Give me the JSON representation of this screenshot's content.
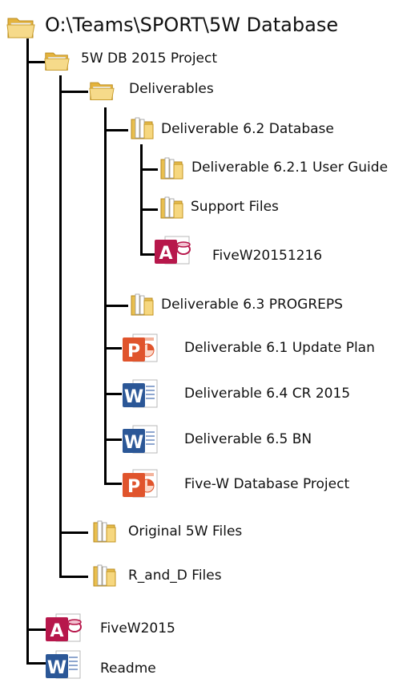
{
  "root": {
    "label": "O:\\Teams\\SPORT\\5W Database"
  },
  "items": [
    {
      "label": "5W DB 2015 Project",
      "icon": "folder-open-icon"
    },
    {
      "label": "Deliverables",
      "icon": "folder-open-icon"
    },
    {
      "label": "Deliverable 6.2 Database",
      "icon": "folder-files-icon"
    },
    {
      "label": "Deliverable 6.2.1 User Guide",
      "icon": "folder-files-icon"
    },
    {
      "label": "Support Files",
      "icon": "folder-files-icon"
    },
    {
      "label": "FiveW20151216",
      "icon": "access-file-icon"
    },
    {
      "label": "Deliverable 6.3 PROGREPS",
      "icon": "folder-files-icon"
    },
    {
      "label": "Deliverable 6.1 Update Plan",
      "icon": "powerpoint-file-icon"
    },
    {
      "label": "Deliverable 6.4 CR 2015",
      "icon": "word-file-icon"
    },
    {
      "label": "Deliverable 6.5 BN",
      "icon": "word-file-icon"
    },
    {
      "label": "Five-W Database Project",
      "icon": "powerpoint-file-icon"
    },
    {
      "label": "Original 5W Files",
      "icon": "folder-files-icon"
    },
    {
      "label": "R_and_D Files",
      "icon": "folder-files-icon"
    },
    {
      "label": "FiveW2015",
      "icon": "access-file-icon"
    },
    {
      "label": "Readme",
      "icon": "word-file-icon"
    }
  ],
  "colors": {
    "line": "#000000",
    "folder": "#f3d27a",
    "access": "#b7174b",
    "powerpoint": "#e0542c",
    "word": "#2b5797"
  }
}
